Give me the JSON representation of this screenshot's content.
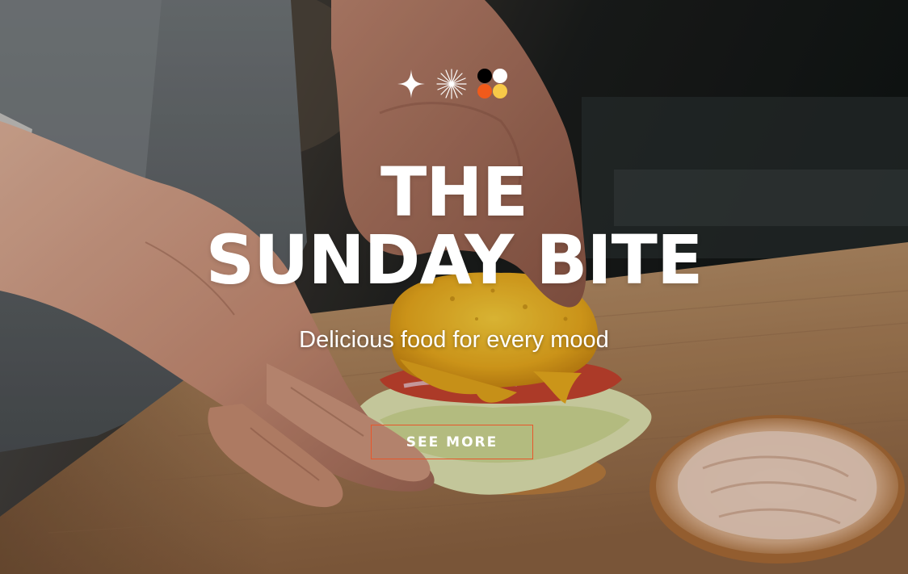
{
  "hero": {
    "background_image": "chef-assembling-burger-photo",
    "title_line1": "THE",
    "title_line2": "SUNDAY BITE",
    "tagline": "Delicious food for every mood",
    "cta_label": "SEE MORE"
  },
  "logo": {
    "icons": [
      "four-point-star-icon",
      "starburst-icon",
      "four-dots-icon"
    ],
    "dot_colors": [
      "#000000",
      "#ffffff",
      "#f05a1a",
      "#f7c948"
    ]
  },
  "colors": {
    "text": "#ffffff",
    "accent_border": "#e8562a"
  }
}
